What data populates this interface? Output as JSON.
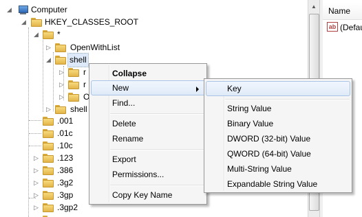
{
  "tree": {
    "computer": "Computer",
    "hkcr": "HKEY_CLASSES_ROOT",
    "star": "*",
    "openwithlist": "OpenWithList",
    "shell": "shell",
    "child1": "r",
    "child2": "r",
    "child3": "O",
    "shellex": "shell",
    "items": [
      ".001",
      ".01c",
      ".10c",
      ".123",
      ".386",
      ".3g2",
      ".3gp",
      ".3gp2"
    ]
  },
  "right_pane": {
    "column_name": "Name",
    "value_icon": "ab",
    "value_name": "(Defau"
  },
  "context_menu": {
    "collapse": "Collapse",
    "new": "New",
    "find": "Find...",
    "delete": "Delete",
    "rename": "Rename",
    "export": "Export",
    "permissions": "Permissions...",
    "copy_key_name": "Copy Key Name"
  },
  "new_submenu": {
    "key": "Key",
    "string_value": "String Value",
    "binary_value": "Binary Value",
    "dword": "DWORD (32-bit) Value",
    "qword": "QWORD (64-bit) Value",
    "multi_string": "Multi-String Value",
    "expandable_string": "Expandable String Value"
  },
  "colors": {
    "menu_bg": "#f5f5f5",
    "highlight": "#dfeaf8",
    "folder": "#f0c75e"
  }
}
